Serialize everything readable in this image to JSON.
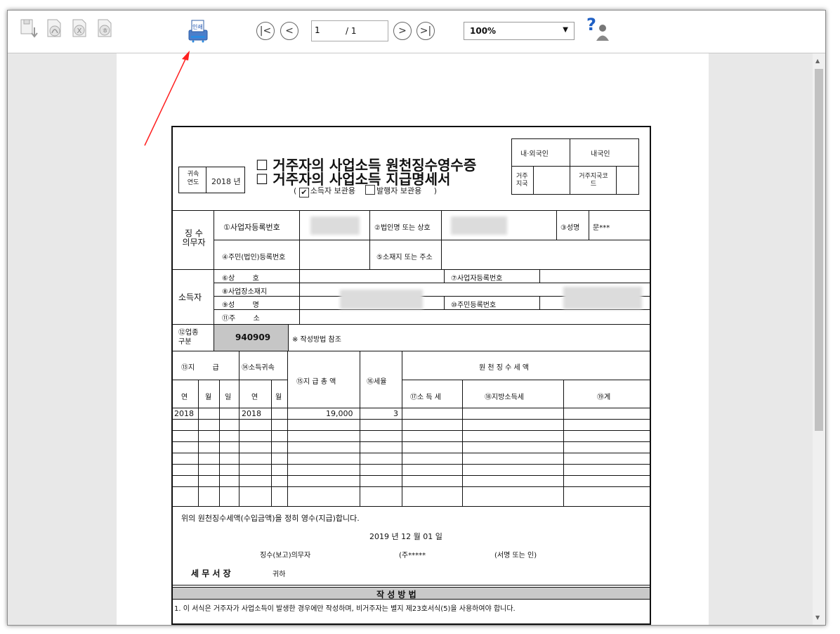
{
  "toolbar": {
    "page_current": "1",
    "page_total": "/ 1",
    "zoom": "100%",
    "print_icon_label": "인쇄",
    "help_glyph": "?"
  },
  "form": {
    "title1": "거주자의 사업소득 원천징수영수증",
    "title2": "거주자의 사업소득 지급명세서",
    "holder_option": "소득자 보관용",
    "issuer_option": "발행자 보관용",
    "year_label": "귀속\n연도",
    "year_value": "2018 년",
    "resident_label": "내·외국인",
    "resident_value": "내국인",
    "residence_label": "거주\n지국",
    "residence_code_label": "거주지국코\n드",
    "payer_label": "징 수\n의무자",
    "biz_reg_no": "①사업자등록번호",
    "corp_name": "②법인명 또는 상호",
    "name3": "③성명",
    "name3_value": "문***",
    "resident_reg_no": "④주민(법인)등록번호",
    "address5": "⑤소재지 또는 주소",
    "recipient_label": "소득자",
    "trade_name": "⑥상        호",
    "biz_reg_no7": "⑦사업자등록번호",
    "biz_location": "⑧사업장소재지",
    "name9": "⑨성        명",
    "resident_reg_no10": "⑩주민등록번호",
    "address11": "⑪주        소",
    "industry_label": "⑫업종\n구분",
    "industry_code": "940909",
    "industry_note": "※ 작성방법 참조",
    "pay_label": "⑬지        급",
    "attribution_label": "⑭소득귀속",
    "pay_total_label": "⑮지 급 총 액",
    "rate_label": "⑯세율",
    "withholding_label": "원 천 징 수 세 액",
    "col_year": "연",
    "col_month": "월",
    "col_day": "일",
    "income_tax_label": "⑰소 득 세",
    "local_tax_label": "⑱지방소득세",
    "total_label": "⑲계",
    "data_row": {
      "pay_year": "2018",
      "attr_year": "2018",
      "amount": "19,000",
      "rate": "3"
    },
    "confirm_text": "위의 원천징수세액(수입금액)을 정히 영수(지급)합니다.",
    "date_text": "2019 년 12 월 01 일",
    "payer_sig": "징수(보고)의무자",
    "payer_sig_value": "(주*****",
    "sign_note": "(서명 또는 인)",
    "tax_office": "세 무 서 장",
    "addressee": "귀하",
    "method_header": "작 성 방 법",
    "method_line1": "1. 이 서식은 거주자가 사업소득이 발생한 경우에만 작성하며, 비거주자는 별지 제23호서식(5)을 사용하여야 합니다."
  }
}
